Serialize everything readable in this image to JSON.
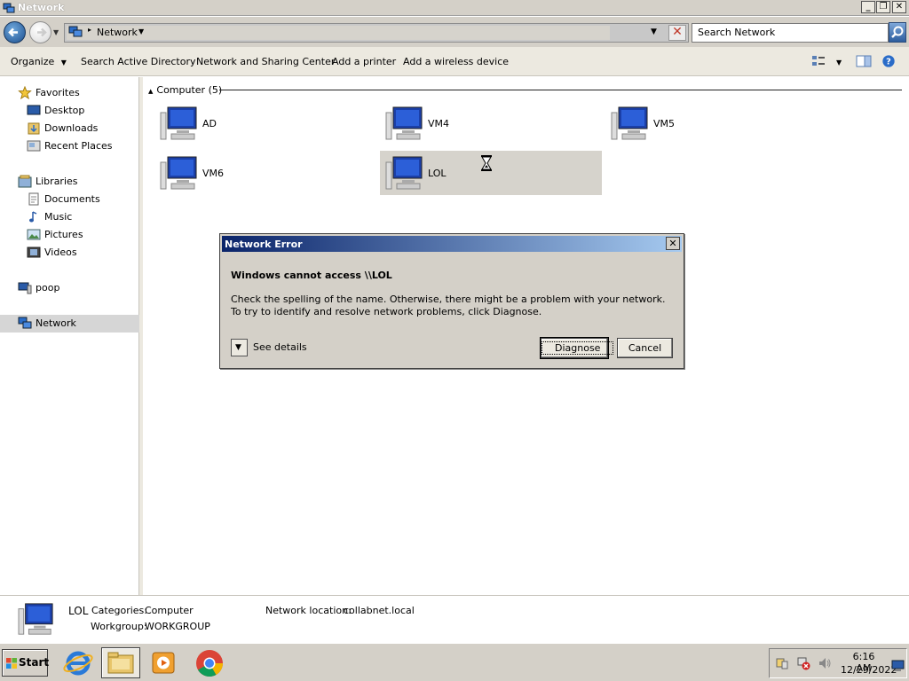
{
  "window": {
    "title": "Network",
    "controls": {
      "minimize": "_",
      "restore": "❐",
      "close": "✕"
    }
  },
  "address": {
    "path": "Network",
    "separator": "▸",
    "search_placeholder": "Search Network"
  },
  "toolbar": {
    "organize": "Organize",
    "items": [
      "Search Active Directory",
      "Network and Sharing Center",
      "Add a printer",
      "Add a wireless device"
    ]
  },
  "sidebar": {
    "favorites": "Favorites",
    "favorite_items": [
      "Desktop",
      "Downloads",
      "Recent Places"
    ],
    "libraries": "Libraries",
    "library_items": [
      "Documents",
      "Music",
      "Pictures",
      "Videos"
    ],
    "computer": "poop",
    "network": "Network"
  },
  "content": {
    "group_header": "Computer (5)",
    "computers": [
      "AD",
      "VM4",
      "VM5",
      "VM6",
      "LOL"
    ],
    "selected": "LOL"
  },
  "dialog": {
    "title": "Network Error",
    "close": "✕",
    "heading": "Windows cannot access \\\\LOL",
    "body": "Check the spelling of the name. Otherwise, there might be a problem with your network. To try to identify and resolve network problems, click Diagnose.",
    "see_details": "See details",
    "diagnose": "Diagnose",
    "cancel": "Cancel"
  },
  "details": {
    "name": "LOL",
    "categories_label": "Categories:",
    "categories_value": "Computer",
    "workgroup_label": "Workgroup:",
    "workgroup_value": "WORKGROUP",
    "location_label": "Network location:",
    "location_value": "collabnet.local"
  },
  "taskbar": {
    "start": "Start",
    "time": "6:16 AM",
    "date": "12/29/2022"
  },
  "colors": {
    "dialog_title_start": "#0a246a",
    "dialog_title_end": "#a6caf0",
    "chrome": "#d4d0c8",
    "selection": "#d6d3cc"
  }
}
